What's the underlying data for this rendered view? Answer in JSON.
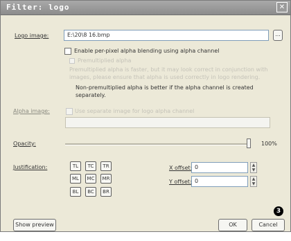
{
  "window": {
    "title": "Filter: logo",
    "close_glyph": "✕"
  },
  "logo_image": {
    "label": "Logo image:",
    "value": "E:\\20\\8 16.bmp",
    "browse_label": "..."
  },
  "per_pixel_alpha": {
    "label": "Enable per-pixel alpha blending using alpha channel",
    "checked": false
  },
  "disabled_lines": [
    "Premultiplied alpha",
    "Premultiplied alpha is faster, but it may look correct in conjunction with",
    "images, please ensure that alpha is used correctly in logo rendering."
  ],
  "alpha_note": {
    "line1": "Non-premultiplied alpha is better if the alpha channel is created",
    "line2": "separately."
  },
  "alpha_image": {
    "label": "Alpha image:",
    "checkbox_label": "Use separate image for logo alpha channel",
    "value": ""
  },
  "opacity": {
    "label": "Opacity:",
    "value_text": "100%",
    "level": 1.0
  },
  "justification": {
    "label": "Justification:",
    "buttons": [
      "TL",
      "TC",
      "TR",
      "ML",
      "MC",
      "MR",
      "BL",
      "BC",
      "BR"
    ]
  },
  "x_offset": {
    "label": "X offset:",
    "value": "0"
  },
  "y_offset": {
    "label": "Y offset:",
    "value": "0"
  },
  "footer": {
    "preview_label": "Show preview",
    "ok_label": "OK",
    "cancel_label": "Cancel"
  },
  "annotation": {
    "number": "3"
  }
}
